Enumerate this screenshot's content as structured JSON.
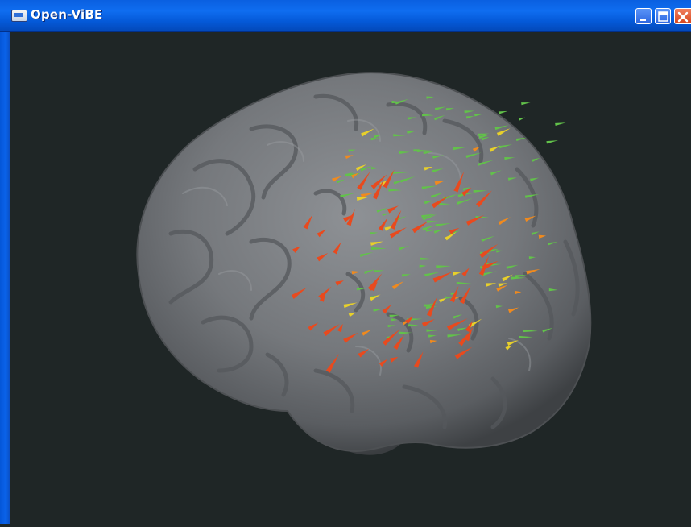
{
  "window": {
    "title": "Open-ViBE",
    "icons": {
      "app": "app-window-icon",
      "minimize": "minimize-icon",
      "maximize": "maximize-icon",
      "close": "close-icon"
    }
  },
  "scene": {
    "description_icon": "3d-brain-render",
    "background_color": "#1f2626",
    "brain_color": "#7a7d80",
    "arrow_colors": {
      "green": "#62c24a",
      "yellow": "#e8d02a",
      "orange": "#f08a1e",
      "red": "#e84a1e"
    }
  }
}
